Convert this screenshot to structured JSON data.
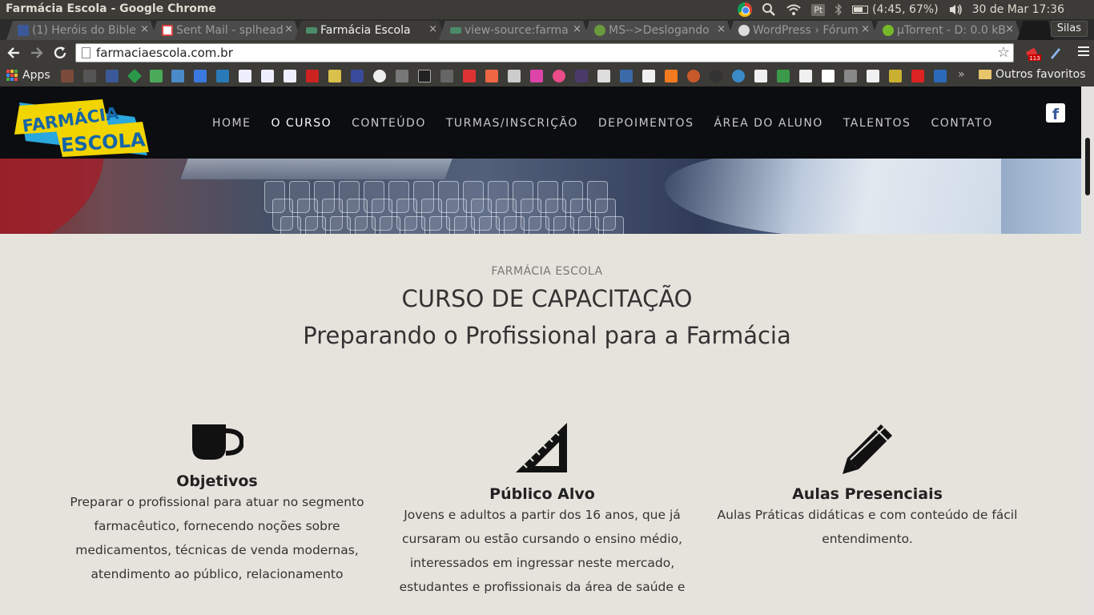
{
  "os": {
    "window_title": "Farmácia Escola - Google Chrome",
    "tray": {
      "pt_label": "Pt",
      "battery_text": "(4:45, 67%)",
      "clock": "30 de Mar 17:36"
    }
  },
  "browser": {
    "tabs": [
      {
        "label": "(1) Heróis do Bible",
        "favicon": "facebook-icon",
        "active": false
      },
      {
        "label": "Sent Mail - splhead",
        "favicon": "gmail-icon",
        "active": false
      },
      {
        "label": "Farmácia Escola",
        "favicon": "site-icon",
        "active": true
      },
      {
        "label": "view-source:farma",
        "favicon": "site-icon",
        "active": false
      },
      {
        "label": "MS-->Deslogando",
        "favicon": "bug-icon",
        "active": false
      },
      {
        "label": "WordPress › Fórum",
        "favicon": "wordpress-icon",
        "active": false
      },
      {
        "label": "µTorrent - D: 0.0 kB",
        "favicon": "utorrent-icon",
        "active": false
      }
    ],
    "user_label": "Silas",
    "url": "farmaciaescola.com.br",
    "ext_badge": "113",
    "bookmarks": {
      "apps_label": "Apps",
      "overflow_label": "»",
      "other_label": "Outros favoritos"
    },
    "colors": {
      "tab_active": "#3c3b37",
      "toolbar": "#3c3b37"
    }
  },
  "site": {
    "logo": {
      "line1": "FARMÁCIA",
      "line2": "ESCOLA"
    },
    "nav": [
      {
        "label": "HOME",
        "active": false
      },
      {
        "label": "O CURSO",
        "active": true
      },
      {
        "label": "CONTEÚDO",
        "active": false
      },
      {
        "label": "TURMAS/INSCRIÇÃO",
        "active": false
      },
      {
        "label": "DEPOIMENTOS",
        "active": false
      },
      {
        "label": "ÁREA DO ALUNO",
        "active": false
      },
      {
        "label": "TALENTOS",
        "active": false
      },
      {
        "label": "CONTATO",
        "active": false
      }
    ],
    "social": {
      "facebook_label": "f"
    },
    "section": {
      "eyebrow": "FARMÁCIA ESCOLA",
      "title": "CURSO DE CAPACITAÇÃO",
      "subtitle": "Preparando o Profissional para a Farmácia"
    },
    "features": [
      {
        "icon": "coffee-cup-icon",
        "title": "Objetivos",
        "text": "Preparar o profissional para atuar no segmento farmacêutico, fornecendo noções sobre medicamentos, técnicas de venda modernas, atendimento ao público, relacionamento"
      },
      {
        "icon": "set-square-icon",
        "title": "Público Alvo",
        "text": "Jovens e adultos a partir dos 16 anos, que já cursaram ou estão cursando o ensino médio, interessados em ingressar neste mercado, estudantes e profissionais da área de saúde e"
      },
      {
        "icon": "pencil-icon",
        "title": "Aulas Presenciais",
        "text": "Aulas Práticas didáticas e com conteúdo de fácil entendimento."
      }
    ],
    "colors": {
      "header_bg": "#0c0d10",
      "content_bg": "#e6e3dd",
      "logo_yellow": "#f2d400",
      "logo_blue": "#2aa7de"
    }
  }
}
